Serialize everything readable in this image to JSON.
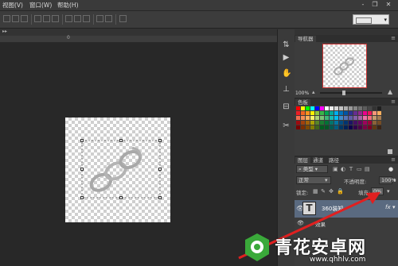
{
  "menu": {
    "items": [
      "视图(V)",
      "窗口(W)",
      "帮助(H)"
    ]
  },
  "window_controls": [
    "-",
    "❐",
    "✕"
  ],
  "navigator": {
    "tab": "导航器",
    "zoom": "100%"
  },
  "swatches": {
    "tab": "色板",
    "colors": [
      "#ff0000",
      "#ffff00",
      "#00ff00",
      "#00ffff",
      "#0000ff",
      "#ff00ff",
      "#ffffff",
      "#ebebeb",
      "#d6d6d6",
      "#c2c2c2",
      "#adadad",
      "#999999",
      "#858585",
      "#707070",
      "#5c5c5c",
      "#474747",
      "#333333",
      "#1f1f1f",
      "#ed1c24",
      "#f26522",
      "#f7941d",
      "#fff200",
      "#8dc63f",
      "#39b54a",
      "#00a651",
      "#00a99d",
      "#00aeef",
      "#0072bc",
      "#0054a6",
      "#2e3192",
      "#662d91",
      "#92278f",
      "#ec008c",
      "#ed145b",
      "#f69679",
      "#fbaf5d",
      "#f26c4f",
      "#f68e56",
      "#fbaf5d",
      "#fff568",
      "#acd373",
      "#7cc576",
      "#3bb878",
      "#1abbb4",
      "#00bff3",
      "#438ccb",
      "#5574b9",
      "#605ca8",
      "#855fa8",
      "#a763a8",
      "#f06ea9",
      "#f26d7d",
      "#c69c6d",
      "#a67c52",
      "#9e0b0f",
      "#a0410d",
      "#a3620a",
      "#aba000",
      "#598527",
      "#1a7b30",
      "#007236",
      "#00746b",
      "#0076a3",
      "#004b80",
      "#003471",
      "#1b1464",
      "#440e62",
      "#630460",
      "#9e005d",
      "#9e0039",
      "#8c6239",
      "#754c24",
      "#790000",
      "#7b2e00",
      "#7d4900",
      "#827b00",
      "#406618",
      "#005e20",
      "#005826",
      "#005952",
      "#005b7f",
      "#003663",
      "#002157",
      "#0d004c",
      "#32004b",
      "#4b0049",
      "#7b0046",
      "#7a0026",
      "#603913",
      "#3c2415"
    ]
  },
  "layers": {
    "tabs": [
      "图层",
      "通道",
      "路径"
    ],
    "kind_label": "类型",
    "blend_mode": "正常",
    "opacity_label": "不透明度:",
    "opacity_value": "100%",
    "lock_label": "锁定:",
    "fill_label": "填充:",
    "fill_value": "0%",
    "layer_name": "360装知",
    "layer_type_glyph": "T",
    "fx_label": "fx",
    "effects_label": "效果"
  },
  "watermark": {
    "title": "青花安卓网",
    "url": "www.qhhlv.com"
  },
  "accent": {
    "selection_blue": "#5a6a80",
    "arrow_red": "#e02020",
    "watermark_green": "#3aa93a"
  }
}
